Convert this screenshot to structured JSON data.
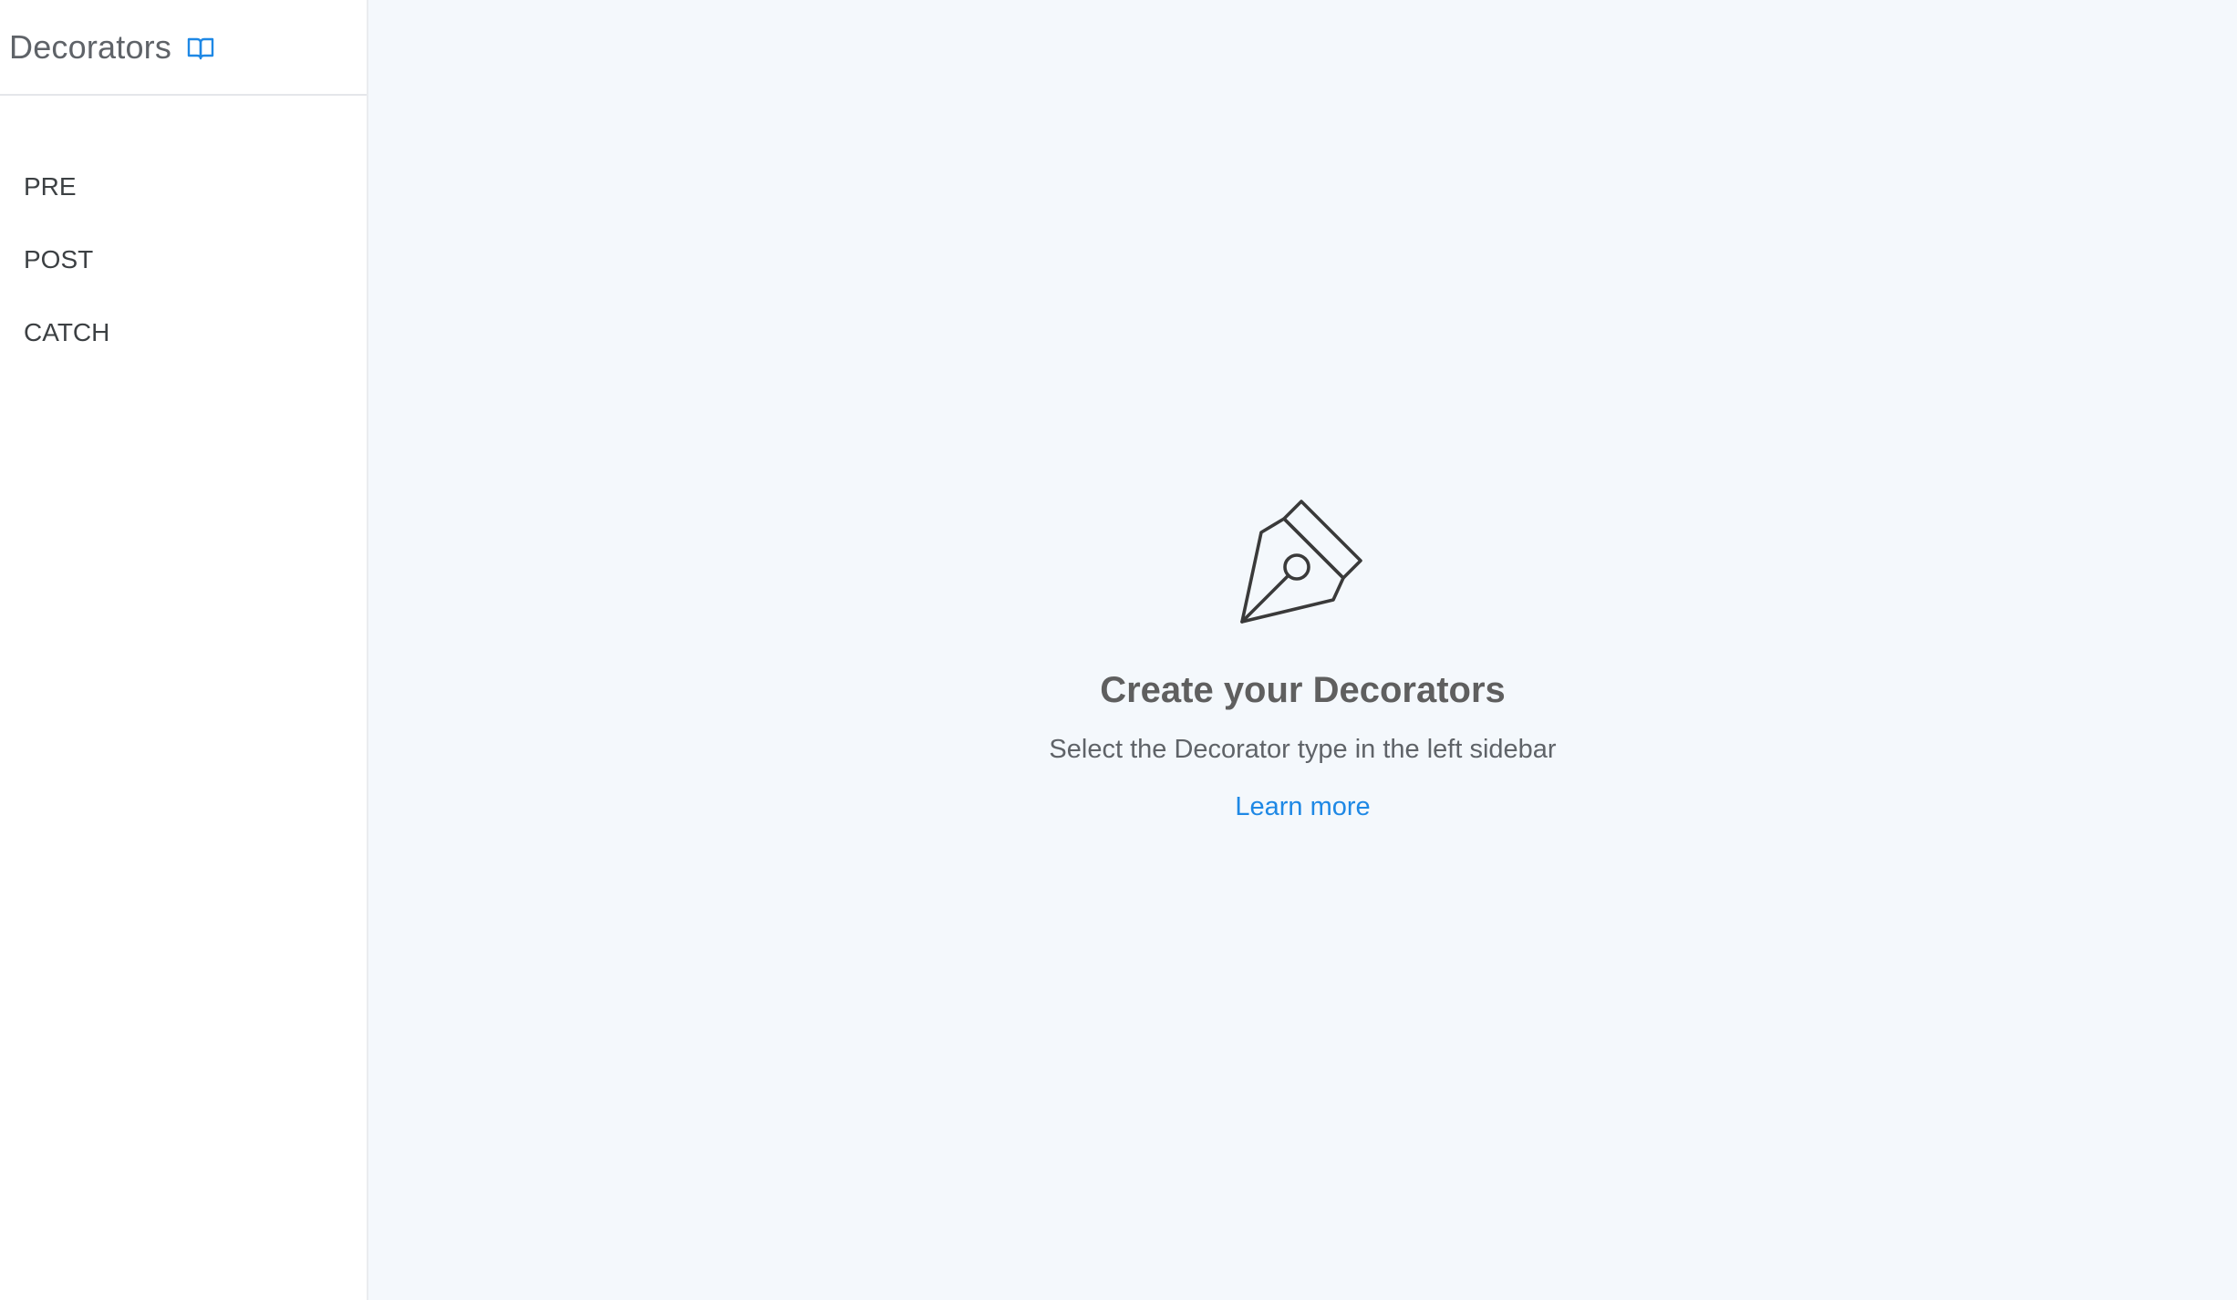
{
  "sidebar": {
    "title": "Decorators",
    "docs_icon": "book-open-icon",
    "items": [
      {
        "label": "PRE"
      },
      {
        "label": "POST"
      },
      {
        "label": "CATCH"
      }
    ]
  },
  "main": {
    "empty_state": {
      "icon": "pen-nib-icon",
      "title": "Create your Decorators",
      "subtitle": "Select the Decorator type in the left sidebar",
      "link_label": "Learn more"
    }
  },
  "colors": {
    "accent": "#1e88e5",
    "sidebar_bg": "#ffffff",
    "main_bg": "#f4f8fc",
    "text_muted": "#5f6368"
  }
}
